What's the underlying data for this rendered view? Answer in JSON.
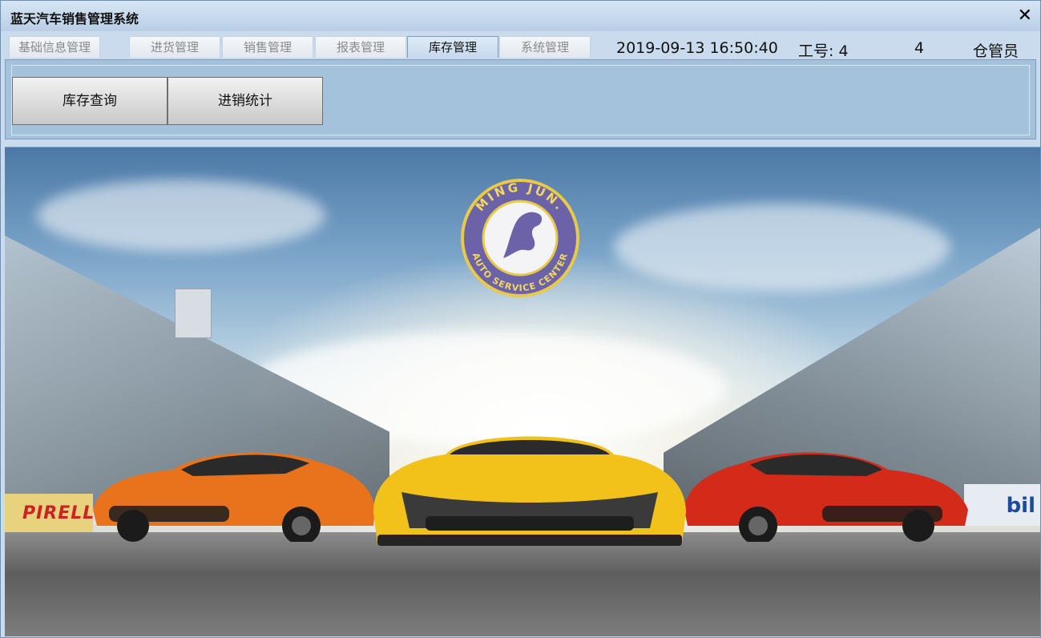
{
  "window": {
    "title": "蓝天汽车销售管理系统",
    "close_glyph": "✕"
  },
  "tabs": [
    {
      "label": "基础信息管理",
      "active": false
    },
    {
      "label": "进货管理",
      "active": false
    },
    {
      "label": "销售管理",
      "active": false
    },
    {
      "label": "报表管理",
      "active": false
    },
    {
      "label": "库存管理",
      "active": true
    },
    {
      "label": "系统管理",
      "active": false
    }
  ],
  "status": {
    "datetime": "2019-09-13 16:50:40",
    "employee_id": "工号: 4",
    "user": "4",
    "role": "仓管员"
  },
  "toolbar": {
    "buttons": [
      {
        "label": "库存查询"
      },
      {
        "label": "进销统计"
      }
    ]
  },
  "banner": {
    "logo": {
      "top_text": "MING JUN.",
      "bottom_text": "AUTO SERVICE CENTER",
      "ring_color": "#6b62a8"
    },
    "ad_left": "PIRELLI",
    "ad_right": "bil"
  },
  "colors": {
    "car_left": "#e8731c",
    "car_center": "#f2c21a",
    "car_right": "#d42a1a"
  }
}
